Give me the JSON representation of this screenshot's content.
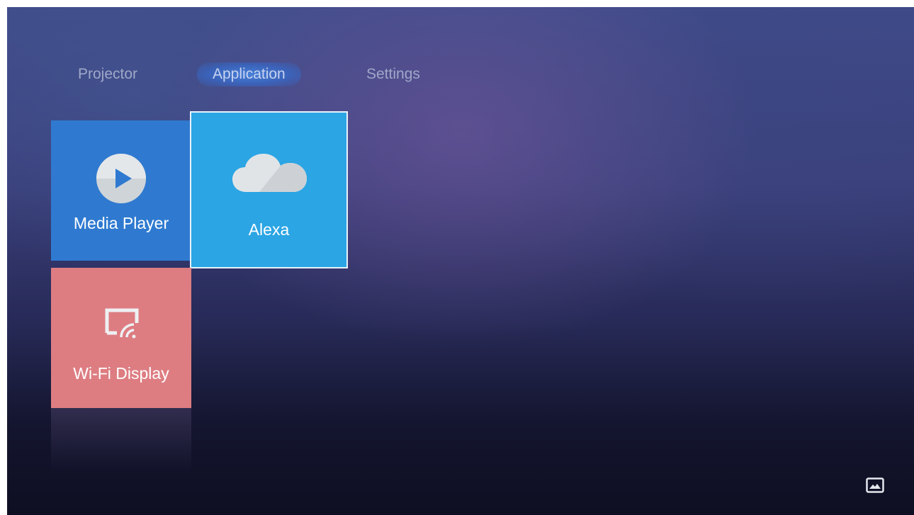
{
  "nav": {
    "tabs": [
      {
        "label": "Projector",
        "active": false
      },
      {
        "label": "Application",
        "active": true
      },
      {
        "label": "Settings",
        "active": false
      }
    ]
  },
  "tiles": [
    {
      "label": "Media Player",
      "icon": "play-icon",
      "color": "#2f7ad0"
    },
    {
      "label": "Alexa",
      "icon": "cloud-icon",
      "color": "#2ba5e4",
      "focused": true
    },
    {
      "label": "Wi-Fi Display",
      "icon": "cast-icon",
      "color": "#dd7d82"
    }
  ],
  "footer": {
    "icon": "image-icon"
  }
}
